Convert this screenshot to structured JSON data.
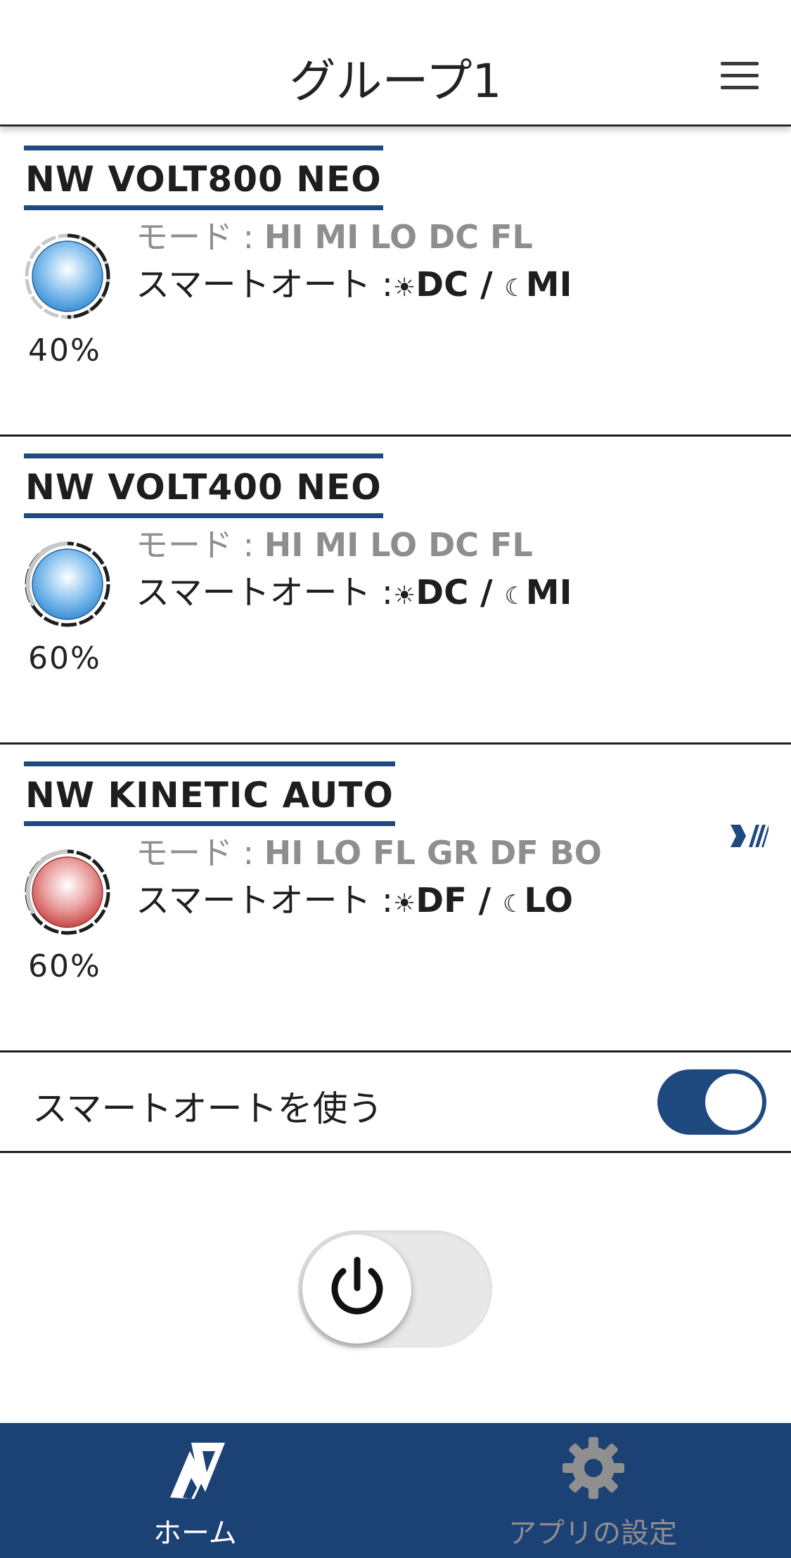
{
  "header": {
    "title": "グループ1",
    "menu_icon": "hamburger-menu-icon"
  },
  "devices": [
    {
      "name": "NW VOLT800 NEO",
      "percent": "40%",
      "color": "#4a9ee0",
      "mode_label": "モード : ",
      "modes": "HI MI LO DC FL",
      "smart_label": "スマートオート :",
      "day_mode": "DC",
      "separator": " / ",
      "night_mode": "MI",
      "day_icon": "sun-icon",
      "night_icon": "moon-icon"
    },
    {
      "name": "NW VOLT400 NEO",
      "percent": "60%",
      "color": "#4a9ee0",
      "mode_label": "モード : ",
      "modes": "HI MI LO DC FL",
      "smart_label": "スマートオート :",
      "day_mode": "DC",
      "separator": " / ",
      "night_mode": "MI",
      "day_icon": "sun-icon",
      "night_icon": "moon-icon"
    },
    {
      "name": "NW KINETIC AUTO",
      "percent": "60%",
      "color": "#d96a6a",
      "mode_label": "モード : ",
      "modes": "HI LO FL GR DF BO",
      "smart_label": "スマートオート :",
      "day_mode": "DF",
      "separator": " / ",
      "night_mode": "LO",
      "day_icon": "sun-icon",
      "night_icon": "moon-icon",
      "badge_icon": "nw-logo-icon"
    }
  ],
  "smart_auto": {
    "label": "スマートオートを使う",
    "enabled": true
  },
  "power": {
    "icon": "power-icon",
    "state": "off"
  },
  "tabbar": {
    "home_label": "ホーム",
    "settings_label": "アプリの設定",
    "active_color": "#ffffff",
    "inactive_color": "#8f8f8f",
    "background": "#1c4175"
  },
  "colors": {
    "brand": "#1f4a80"
  }
}
